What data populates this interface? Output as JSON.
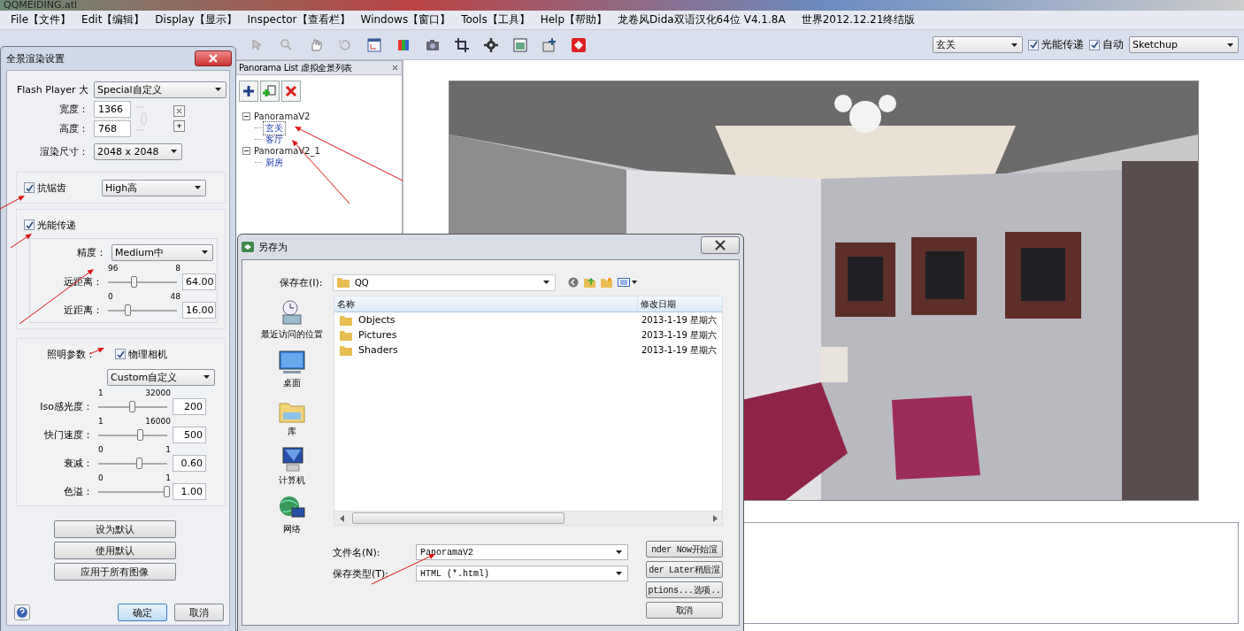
{
  "window": {
    "title": "QQMEIDING.atl"
  },
  "menu": [
    "File【文件】",
    "Edit【编辑】",
    "Display【显示】",
    "Inspector【查看栏】",
    "Windows【窗口】",
    "Tools【工具】",
    "Help【帮助】"
  ],
  "title_notes": [
    "龙卷风Dida双语汉化64位 V4.1.8A",
    "世界2012.12.21终结版"
  ],
  "toolbar": {
    "scene": "玄关",
    "radiosity": {
      "label": "光能传递",
      "checked": true
    },
    "auto": {
      "label": "自动",
      "checked": true
    },
    "preset": "Sketchup"
  },
  "panorama_list": {
    "title": "Panorama List 虚拟全景列表",
    "tree": [
      {
        "label": "PanoramaV2",
        "expanded": true,
        "selected": false,
        "children": [
          {
            "label": "玄关",
            "selected": true
          },
          {
            "label": "客厅",
            "selected": false
          }
        ]
      },
      {
        "label": "PanoramaV2_1",
        "expanded": true,
        "selected": false,
        "children": [
          {
            "label": "厨房",
            "selected": false
          }
        ]
      }
    ]
  },
  "render_settings": {
    "title": "全景渲染设置",
    "output": {
      "label": "Flash Player 大",
      "value": "Special自定义"
    },
    "width": {
      "label": "宽度：",
      "value": "1366"
    },
    "height": {
      "label": "高度：",
      "value": "768"
    },
    "render_size": {
      "label": "渲染尺寸：",
      "value": "2048 x 2048"
    },
    "antialias": {
      "label": "抗锯齿",
      "checked": true,
      "quality": "High高"
    },
    "radiosity": {
      "label": "光能传递",
      "checked": true,
      "precision_label": "精度：",
      "precision": "Medium中",
      "sliders": [
        {
          "label": "远距离：",
          "min": "96",
          "max": "8",
          "level": 0.38,
          "value": "64.00"
        },
        {
          "label": "近距离：",
          "min": "0",
          "max": "48",
          "level": 0.3,
          "value": "16.00"
        }
      ]
    },
    "lighting": {
      "label": "照明参数：",
      "camera": {
        "label": "物理相机",
        "checked": true
      },
      "mode": "Custom自定义",
      "sliders": [
        {
          "label": "Iso感光度：",
          "min": "1",
          "max": "32000",
          "level": 0.5,
          "value": "200"
        },
        {
          "label": "快门速度：",
          "min": "1",
          "max": "16000",
          "level": 0.62,
          "value": "500"
        },
        {
          "label": "衰减：",
          "min": "0",
          "max": "1",
          "level": 0.6,
          "value": "0.60"
        },
        {
          "label": "色溢：",
          "min": "0",
          "max": "1",
          "level": 1,
          "value": "1.00"
        }
      ]
    },
    "buttons": [
      "设为默认",
      "使用默认",
      "应用于所有图像"
    ],
    "ok": "确定",
    "cancel": "取消"
  },
  "save_dialog": {
    "title": "另存为",
    "save_in": {
      "label": "保存在(I):",
      "value": "QQ"
    },
    "places": [
      {
        "label": "最近访问的位置",
        "kind": "recent"
      },
      {
        "label": "桌面",
        "kind": "desktop"
      },
      {
        "label": "库",
        "kind": "library"
      },
      {
        "label": "计算机",
        "kind": "computer"
      },
      {
        "label": "网络",
        "kind": "network"
      }
    ],
    "columns": [
      "名称",
      "修改日期"
    ],
    "files": [
      {
        "name": "Objects",
        "modified": "2013-1-19 星期六"
      },
      {
        "name": "Pictures",
        "modified": "2013-1-19 星期六"
      },
      {
        "name": "Shaders",
        "modified": "2013-1-19 星期六"
      }
    ],
    "file_name": {
      "label": "文件名(N):",
      "value": "PanoramaV2"
    },
    "file_type": {
      "label": "保存类型(T):",
      "value": "HTML (*.html)"
    },
    "buttons": [
      "nder Now开始渲",
      "der Later稍后渲",
      "ptions...选项..",
      "取消"
    ]
  }
}
